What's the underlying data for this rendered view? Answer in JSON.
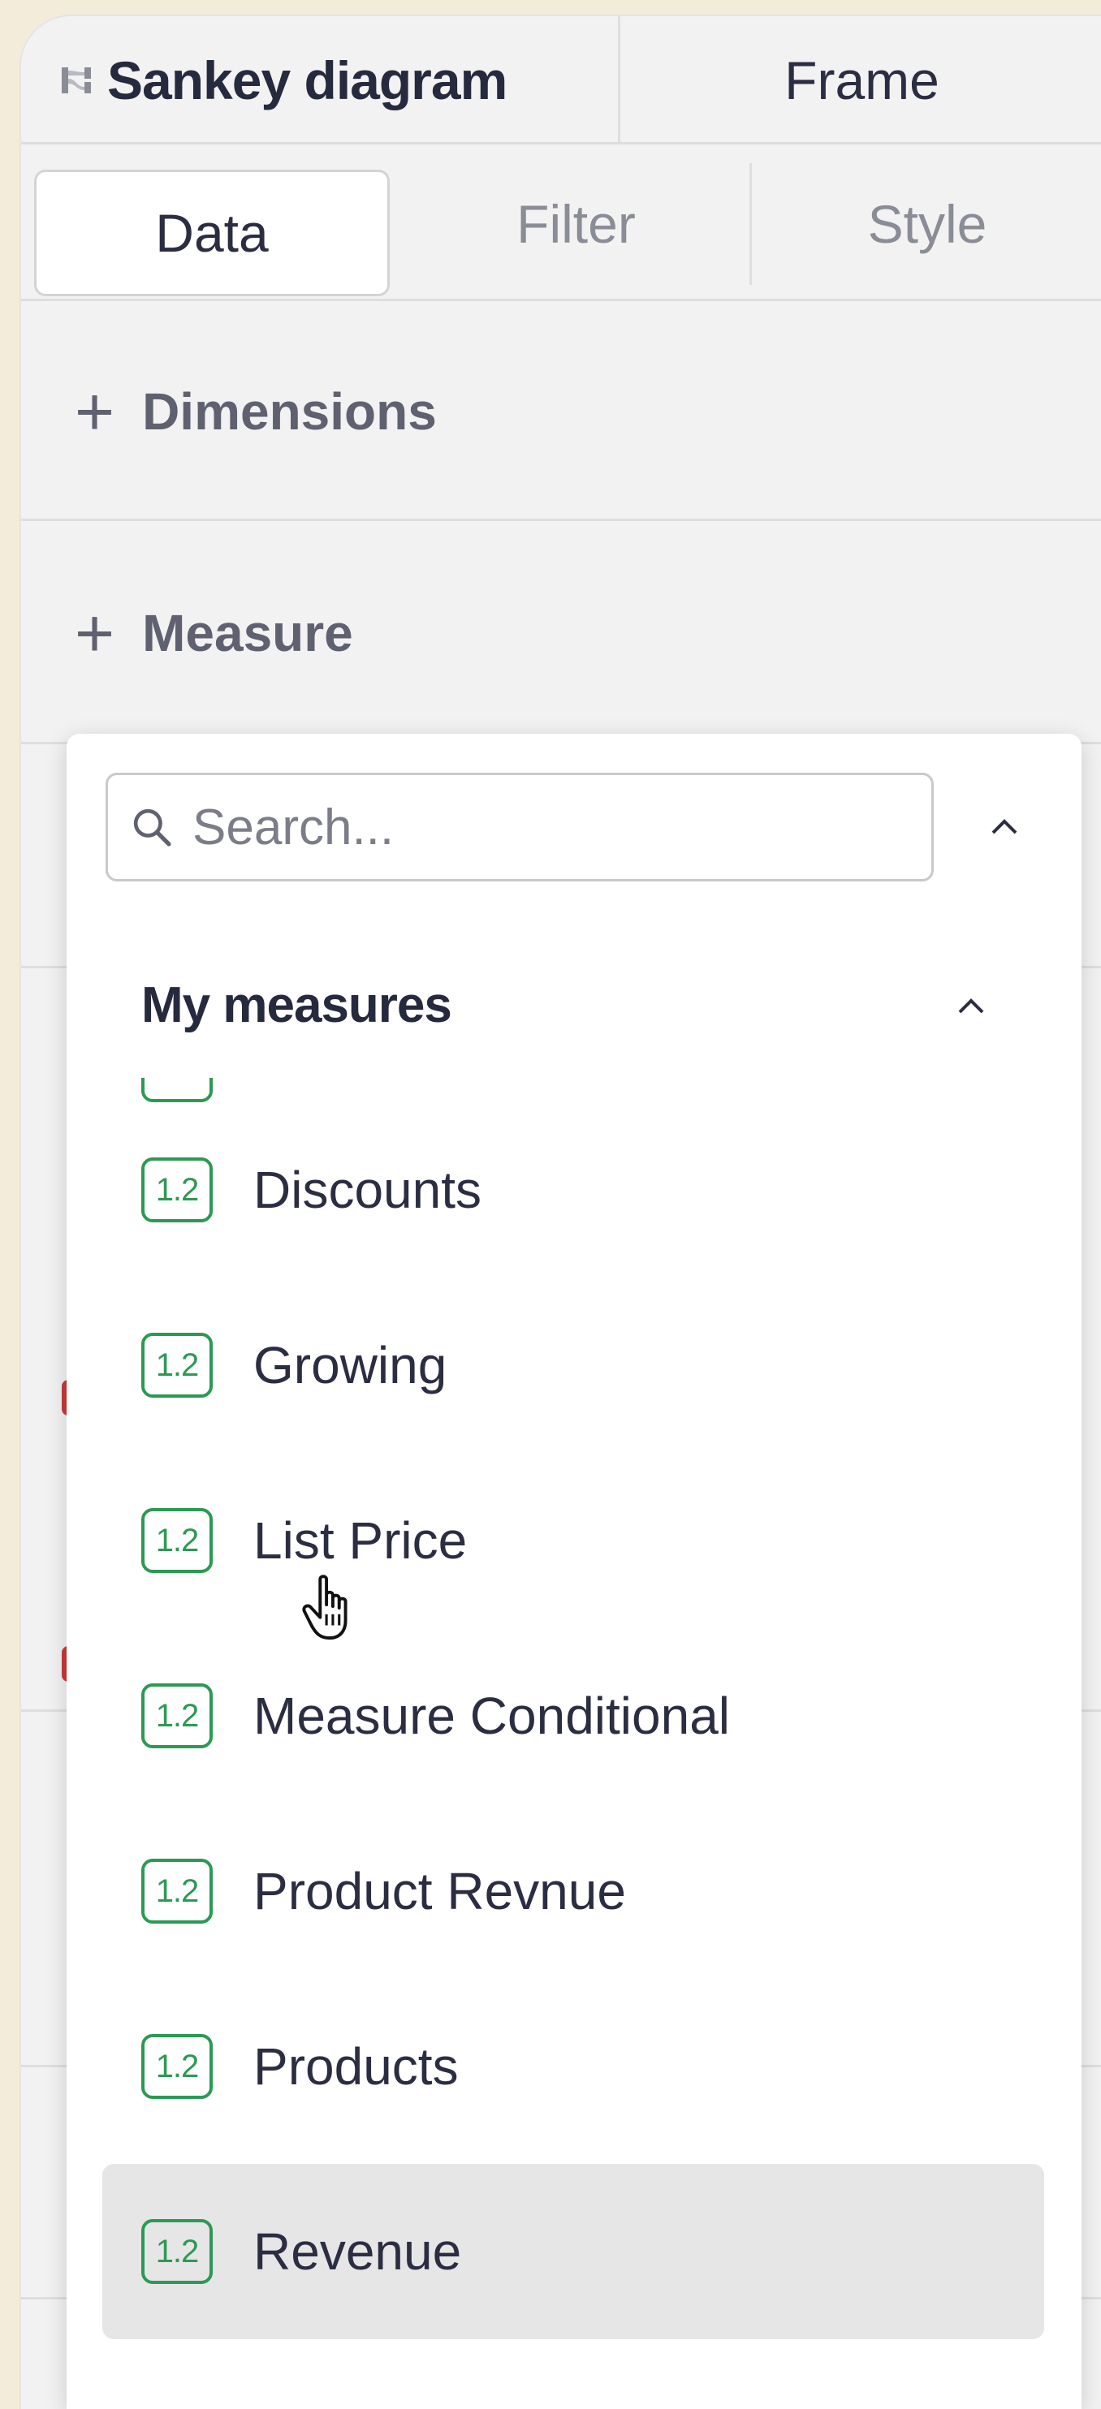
{
  "header": {
    "chart_tab_label": "Sankey diagram",
    "chart_tab_icon": "sankey-icon",
    "frame_tab_label": "Frame"
  },
  "subtabs": {
    "data": "Data",
    "filter": "Filter",
    "style": "Style",
    "active": "Data"
  },
  "sections": {
    "dimensions": "Dimensions",
    "measure": "Measure"
  },
  "dropdown": {
    "search_placeholder": "Search...",
    "search_value": "",
    "group_label": "My measures",
    "badge_text": "1.2",
    "items": [
      {
        "label": "Discounts"
      },
      {
        "label": "Growing"
      },
      {
        "label": "List Price"
      },
      {
        "label": "Measure Conditional"
      },
      {
        "label": "Product Revnue"
      },
      {
        "label": "Products"
      },
      {
        "label": "Revenue"
      }
    ],
    "hovered_item": "Revenue"
  },
  "colors": {
    "badge_green": "#2c9a53",
    "panel_bg": "#f2f2f2",
    "backdrop": "#f3ecda",
    "hover_bg": "#e6e6e6"
  },
  "icons": {
    "search": "search-icon",
    "collapse": "chevron-up-icon",
    "cursor": "hand-pointer-icon"
  }
}
